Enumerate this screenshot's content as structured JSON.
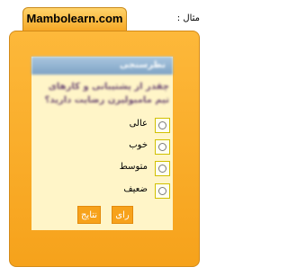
{
  "example_label": "مثال :",
  "site_title": "Mambolearn.com",
  "poll": {
    "header": "نظرسنجی",
    "question": "چقدر از پشتیبانی و کارهای تیم مامبولیرن رضایت دارید؟",
    "options": [
      {
        "label": "عالی"
      },
      {
        "label": "خوب"
      },
      {
        "label": "متوسط"
      },
      {
        "label": "ضعیف"
      }
    ],
    "vote_button": "رای",
    "results_button": "نتایج"
  }
}
